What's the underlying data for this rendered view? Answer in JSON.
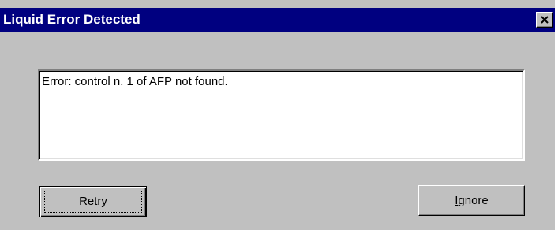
{
  "window": {
    "title": "Liquid Error Detected",
    "close_symbol": "close-icon"
  },
  "message": {
    "text": "Error: control n. 1 of AFP not found."
  },
  "buttons": {
    "retry": {
      "mnemonic": "R",
      "rest": "etry"
    },
    "ignore": {
      "mnemonic": "I",
      "rest": "gnore"
    }
  },
  "colors": {
    "titlebar": "#000080",
    "face": "#c0c0c0"
  }
}
